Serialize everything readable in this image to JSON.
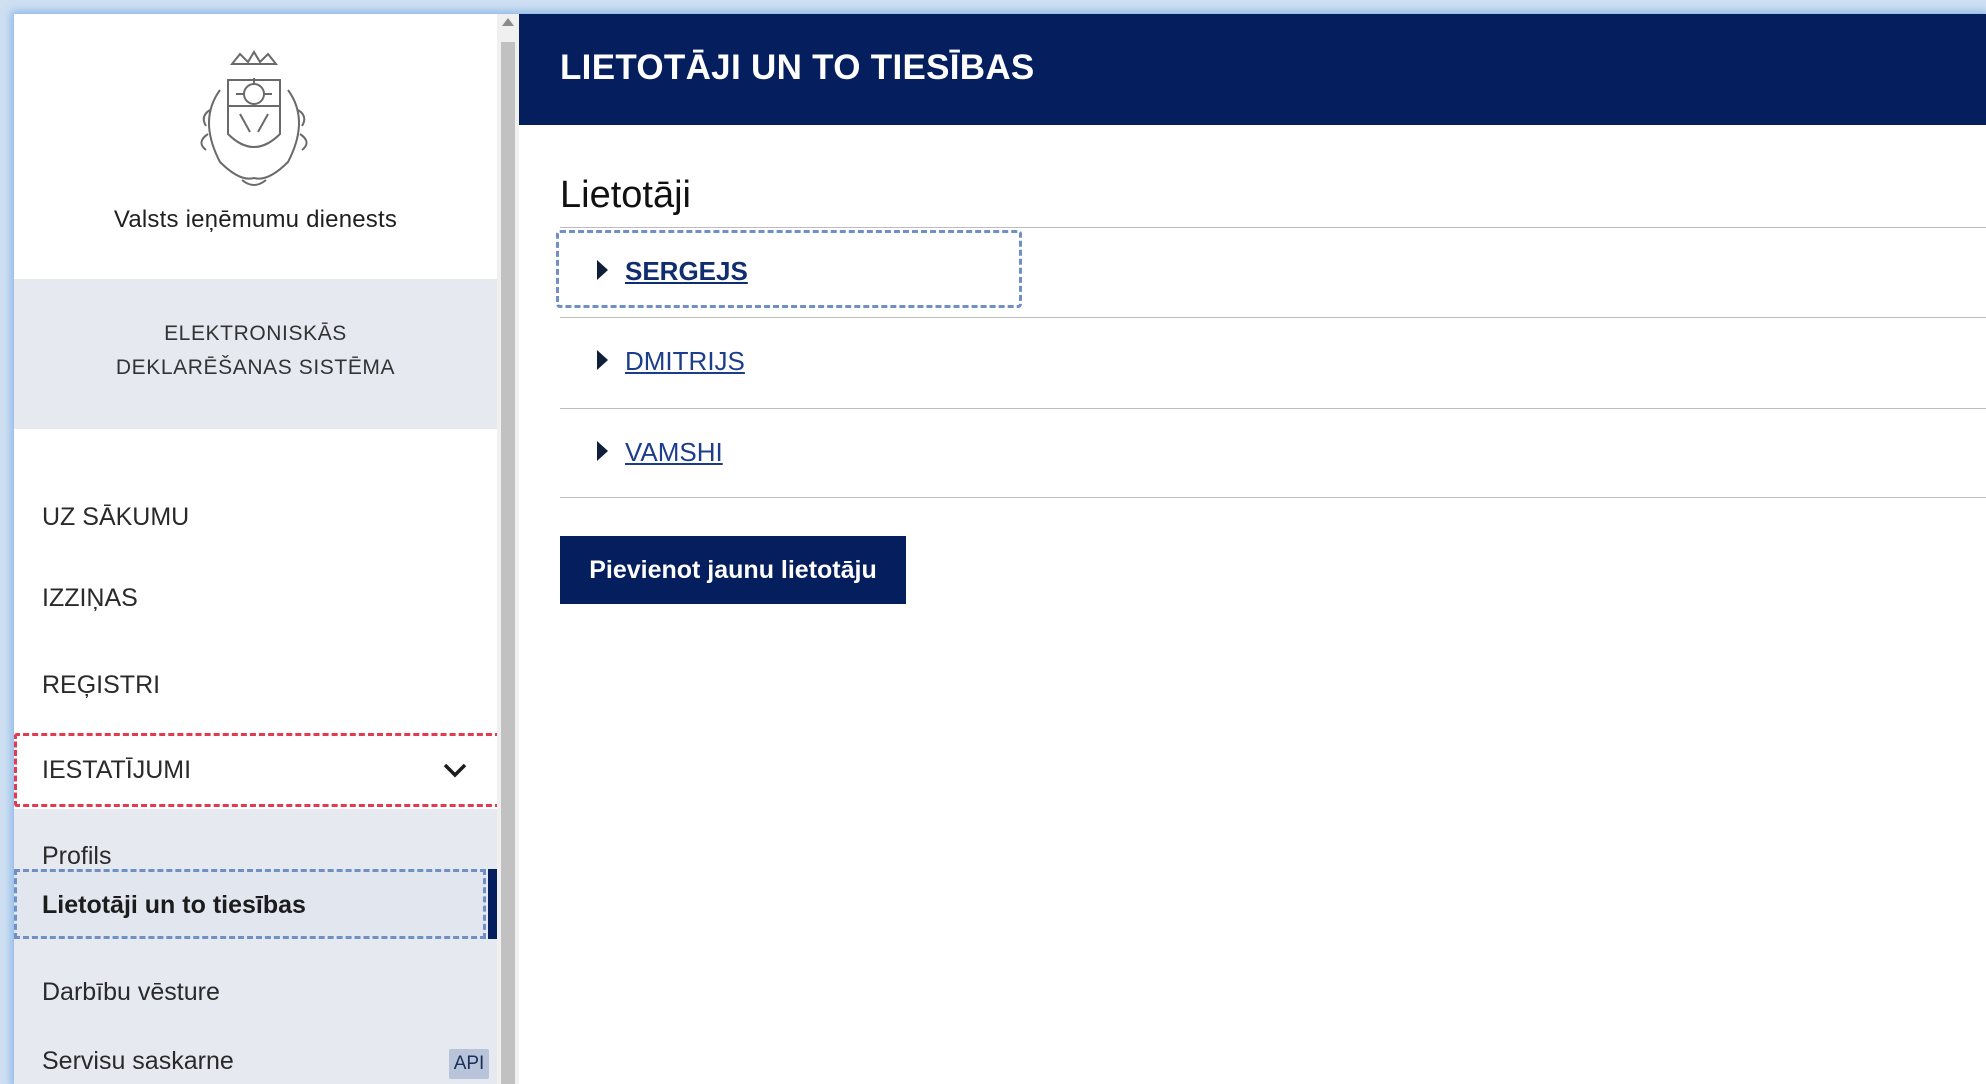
{
  "sidebar": {
    "org_name": "Valsts ieņēmumu dienests",
    "system_line1": "ELEKTRONISKĀS",
    "system_line2": "DEKLARĒŠANAS SISTĒMA",
    "nav": [
      {
        "label": "UZ SĀKUMU"
      },
      {
        "label": "IZZIŅAS"
      },
      {
        "label": "REĢISTRI"
      }
    ],
    "settings": {
      "label": "IESTATĪJUMI",
      "icon": "chevron-down-icon"
    },
    "submenu": [
      {
        "label": "Profils"
      },
      {
        "label": "Lietotāji un to tiesības",
        "active": true
      },
      {
        "label": "Darbību vēsture"
      },
      {
        "label": "Servisu saskarne",
        "badge": "API"
      }
    ]
  },
  "header": {
    "title": "LIETOTĀJI UN TO TIESĪBAS"
  },
  "main": {
    "section_title": "Lietotāji",
    "users": [
      {
        "name": "SERGEJS",
        "focused": true
      },
      {
        "name": "DMITRIJS"
      },
      {
        "name": "VAMSHI"
      }
    ],
    "add_button": "Pievienot jaunu lietotāju"
  },
  "colors": {
    "navy": "#041e5e",
    "sidebar_gray": "#e6e9f0",
    "focus_outline": "#6f8fc5",
    "settings_outline": "#e23b4f"
  }
}
